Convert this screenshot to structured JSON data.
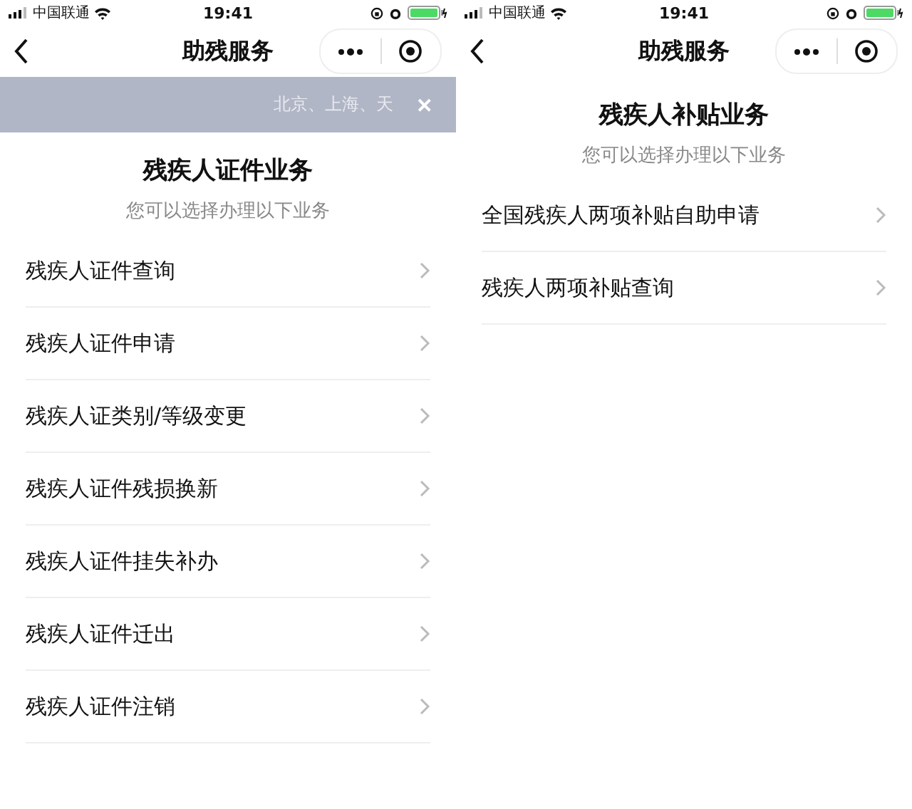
{
  "screens": [
    {
      "status_bar": {
        "carrier": "中国联通",
        "time": "19:41"
      },
      "nav": {
        "title": "助残服务"
      },
      "banner": {
        "text": "北京、上海、天",
        "close": "✕"
      },
      "section": {
        "title": "残疾人证件业务",
        "subtitle": "您可以选择办理以下业务"
      },
      "items": [
        {
          "label": "残疾人证件查询"
        },
        {
          "label": "残疾人证件申请"
        },
        {
          "label": "残疾人证类别/等级变更"
        },
        {
          "label": "残疾人证件残损换新"
        },
        {
          "label": "残疾人证件挂失补办"
        },
        {
          "label": "残疾人证件迁出"
        },
        {
          "label": "残疾人证件注销"
        }
      ]
    },
    {
      "status_bar": {
        "carrier": "中国联通",
        "time": "19:41"
      },
      "nav": {
        "title": "助残服务"
      },
      "section": {
        "title": "残疾人补贴业务",
        "subtitle": "您可以选择办理以下业务"
      },
      "items": [
        {
          "label": "全国残疾人两项补贴自助申请"
        },
        {
          "label": "残疾人两项补贴查询"
        }
      ]
    }
  ]
}
